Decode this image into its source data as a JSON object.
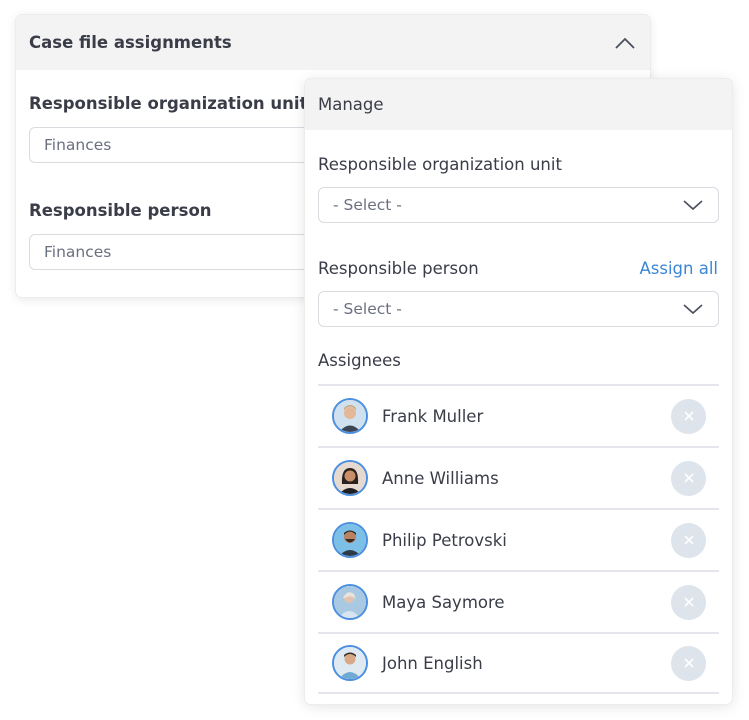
{
  "back_card": {
    "title": "Case file assignments",
    "fields": [
      {
        "label": "Responsible organization unit",
        "value": "Finances"
      },
      {
        "label": "Responsible person",
        "value": "Finances"
      }
    ]
  },
  "manage_panel": {
    "title": "Manage",
    "org_unit": {
      "label": "Responsible organization unit",
      "placeholder": "- Select -"
    },
    "person": {
      "label": "Responsible person",
      "placeholder": "- Select -",
      "assign_all": "Assign all"
    },
    "assignees_label": "Assignees",
    "assignees": [
      {
        "name": "Frank Muller"
      },
      {
        "name": "Anne Williams"
      },
      {
        "name": "Philip Petrovski"
      },
      {
        "name": "Maya Saymore"
      },
      {
        "name": "John English"
      }
    ]
  },
  "colors": {
    "accent": "#3b86d6",
    "avatar_ring": "#4a8fe0",
    "header_bg": "#f3f3f4",
    "remove_bg": "#dde4ec"
  }
}
